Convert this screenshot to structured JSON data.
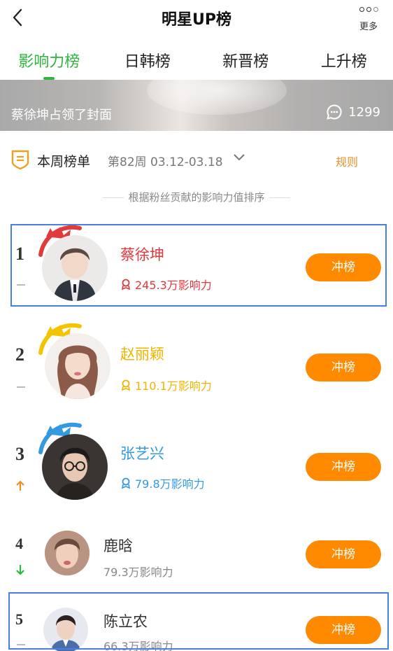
{
  "navbar": {
    "title": "明星UP榜",
    "more_label": "更多"
  },
  "tabs": [
    {
      "label": "影响力榜",
      "active": true
    },
    {
      "label": "日韩榜",
      "active": false
    },
    {
      "label": "新晋榜",
      "active": false
    },
    {
      "label": "上升榜",
      "active": false
    }
  ],
  "banner": {
    "text": "蔡徐坤占领了封面",
    "comment_count": "1299"
  },
  "week": {
    "label": "本周榜单",
    "period": "第82周 03.12-03.18",
    "rules": "规则"
  },
  "subtitle": "根据粉丝贡献的影响力值排序",
  "ranking": [
    {
      "rank": "1",
      "name": "蔡徐坤",
      "score": "245.3万影响力",
      "button": "冲榜",
      "color": "#e0383e",
      "trend": "same"
    },
    {
      "rank": "2",
      "name": "赵丽颖",
      "score": "110.1万影响力",
      "button": "冲榜",
      "color": "#f0b400",
      "trend": "same"
    },
    {
      "rank": "3",
      "name": "张艺兴",
      "score": "79.8万影响力",
      "button": "冲榜",
      "color": "#3399e0",
      "trend": "up"
    },
    {
      "rank": "4",
      "name": "鹿晗",
      "score": "79.3万影响力",
      "button": "冲榜",
      "color": "#333333",
      "trend": "down"
    },
    {
      "rank": "5",
      "name": "陈立农",
      "score": "66.3万影响力",
      "button": "冲榜",
      "color": "#333333",
      "trend": "same"
    }
  ],
  "colors": {
    "accent_green": "#2fb540",
    "button_orange": "#ff8a00",
    "rules_orange": "#e8902a",
    "selection_blue": "#4a7ee0"
  }
}
